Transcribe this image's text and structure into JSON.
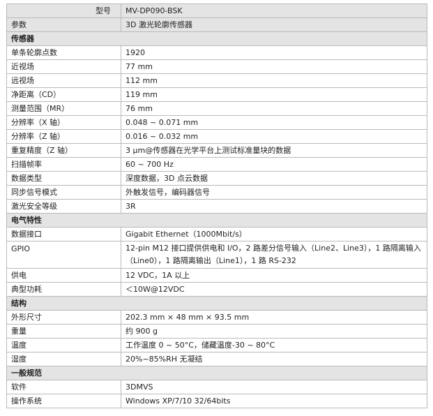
{
  "header": {
    "model_label": "型号",
    "model_value": "MV-DP090-BSK",
    "param_label": "参数",
    "param_value": "3D 激光轮廓传感器"
  },
  "sections": [
    {
      "title": "传感器",
      "rows": [
        {
          "key": "单条轮廓点数",
          "value": "1920"
        },
        {
          "key": "近视场",
          "value": "77 mm"
        },
        {
          "key": "远视场",
          "value": "112 mm"
        },
        {
          "key": "净距离（CD）",
          "value": "119 mm"
        },
        {
          "key": "测量范围（MR）",
          "value": "76 mm"
        },
        {
          "key": "分辨率（X 轴）",
          "value": "0.048 ~ 0.071 mm"
        },
        {
          "key": "分辨率（Z 轴）",
          "value": "0.016 ~ 0.032 mm"
        },
        {
          "key": "重复精度（Z 轴）",
          "value": "3 μm@传感器在光学平台上测试标准量块的数据"
        },
        {
          "key": "扫描帧率",
          "value": "60 ~ 700 Hz"
        },
        {
          "key": "数据类型",
          "value": "深度数据，3D 点云数据"
        },
        {
          "key": "同步信号模式",
          "value": "外触发信号，编码器信号"
        },
        {
          "key": "激光安全等级",
          "value": "3R"
        }
      ]
    },
    {
      "title": "电气特性",
      "rows": [
        {
          "key": "数据接口",
          "value": "Gigabit Ethernet（1000Mbit/s）"
        },
        {
          "key": "GPIO",
          "value": "12-pin M12 接口提供供电和 I/O，2 路差分信号输入（Line2、Line3），1 路隔离输入（Line0），1 路隔离输出（Line1），1 路 RS-232"
        },
        {
          "key": "供电",
          "value": "12 VDC，1A 以上"
        },
        {
          "key": "典型功耗",
          "value": "＜10W@12VDC"
        }
      ]
    },
    {
      "title": "结构",
      "rows": [
        {
          "key": "外形尺寸",
          "value": "202.3 mm × 48 mm × 93.5 mm"
        },
        {
          "key": "重量",
          "value": "约 900 g"
        },
        {
          "key": "温度",
          "value": "工作温度 0 ~ 50°C，储藏温度-30 ~ 80°C"
        },
        {
          "key": "湿度",
          "value": "20%~85%RH 无凝结"
        }
      ]
    },
    {
      "title": "一般规范",
      "rows": [
        {
          "key": "软件",
          "value": "3DMVS"
        },
        {
          "key": "操作系统",
          "value": "Windows XP/7/10 32/64bits"
        }
      ]
    }
  ]
}
